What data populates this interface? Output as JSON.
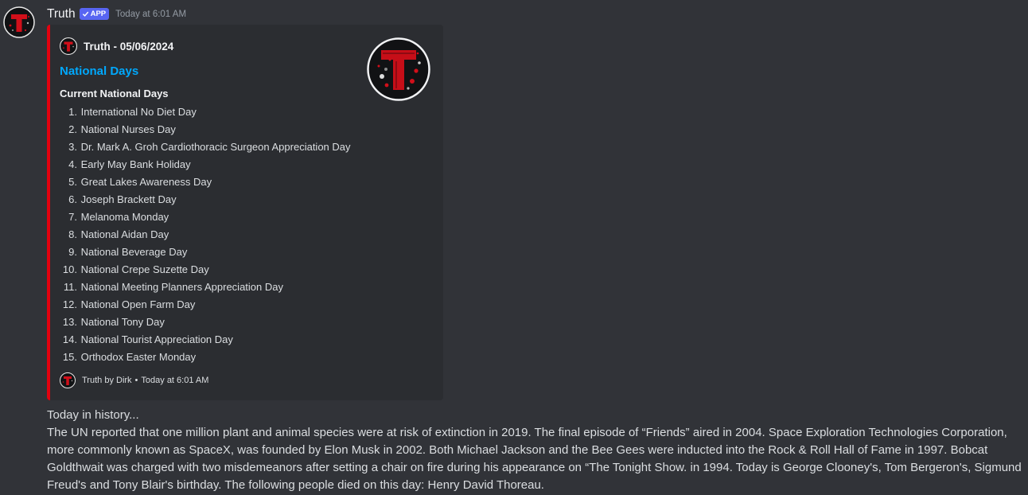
{
  "message": {
    "author": "Truth",
    "badge": "APP",
    "timestamp": "Today at 6:01 AM"
  },
  "embed": {
    "accent_color": "#e3010f",
    "author_name": "Truth - 05/06/2024",
    "title": "National Days",
    "field_name": "Current National Days",
    "days": [
      {
        "num": "1.",
        "label": "International No Diet Day"
      },
      {
        "num": "2.",
        "label": "National Nurses Day"
      },
      {
        "num": "3.",
        "label": "Dr. Mark A. Groh Cardiothoracic Surgeon Appreciation Day"
      },
      {
        "num": "4.",
        "label": "Early May Bank Holiday"
      },
      {
        "num": "5.",
        "label": "Great Lakes Awareness Day"
      },
      {
        "num": "6.",
        "label": "Joseph Brackett Day"
      },
      {
        "num": "7.",
        "label": "Melanoma Monday"
      },
      {
        "num": "8.",
        "label": "National Aidan Day"
      },
      {
        "num": "9.",
        "label": "National Beverage Day"
      },
      {
        "num": "10.",
        "label": "National Crepe Suzette Day"
      },
      {
        "num": "11.",
        "label": "National Meeting Planners Appreciation Day"
      },
      {
        "num": "12.",
        "label": "National Open Farm Day"
      },
      {
        "num": "13.",
        "label": "National Tony Day"
      },
      {
        "num": "14.",
        "label": "National Tourist Appreciation Day"
      },
      {
        "num": "15.",
        "label": "Orthodox Easter Monday"
      }
    ],
    "footer_text": "Truth by Dirk",
    "footer_separator": "•",
    "footer_time": "Today at 6:01 AM"
  },
  "history": {
    "intro": "Today in history...",
    "body": "The UN reported that one million plant and animal species were at risk of extinction in 2019. The final episode of “Friends” aired in 2004. Space Exploration Technologies Corporation, more commonly known as SpaceX, was founded by Elon Musk in 2002. Both Michael Jackson and the Bee Gees were inducted into the Rock & Roll Hall of Fame in 1997. Bobcat Goldthwait was charged with two misdemeanors after setting a chair on fire during his appearance on “The Tonight Show. in 1994. Today is George Clooney's, Tom Bergeron's, Sigmund Freud's and Tony Blair's birthday. The following people died on this day: Henry David Thoreau."
  }
}
